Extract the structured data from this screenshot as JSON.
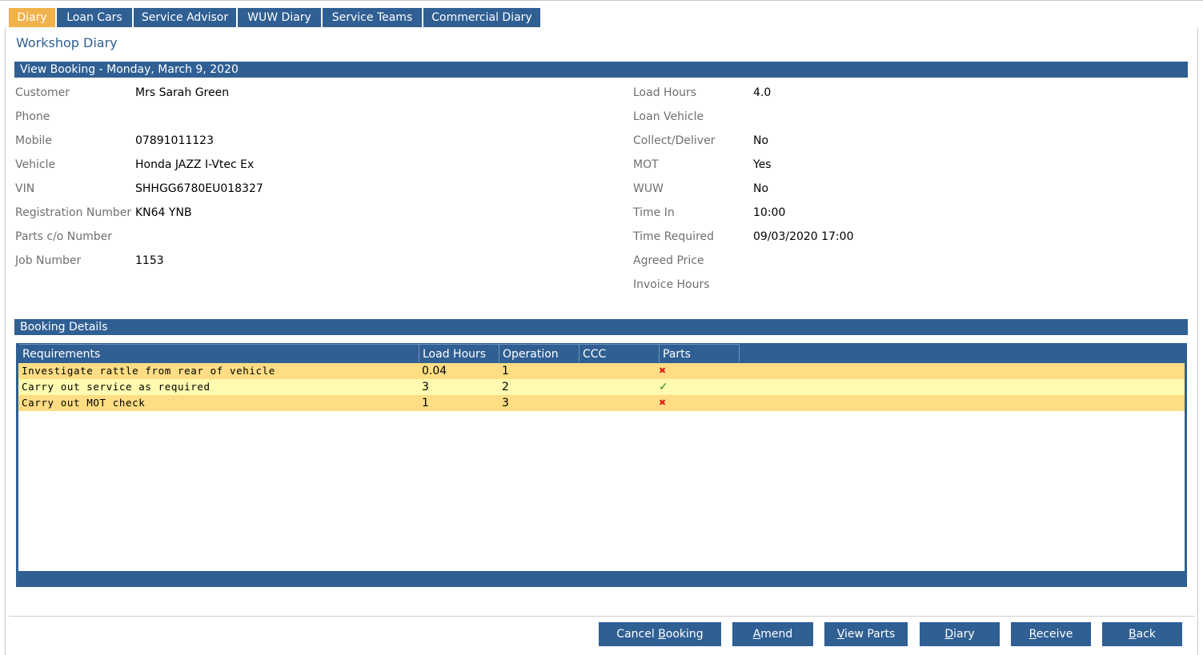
{
  "tabs": [
    {
      "label": "Diary",
      "active": true
    },
    {
      "label": "Loan Cars",
      "active": false
    },
    {
      "label": "Service Advisor",
      "active": false
    },
    {
      "label": "WUW Diary",
      "active": false
    },
    {
      "label": "Service Teams",
      "active": false
    },
    {
      "label": "Commercial Diary",
      "active": false
    }
  ],
  "page_title": "Workshop Diary",
  "booking_header": "View Booking - Monday, March 9, 2020",
  "left_fields": [
    {
      "label": "Customer",
      "value": "Mrs Sarah Green"
    },
    {
      "label": "Phone",
      "value": ""
    },
    {
      "label": "Mobile",
      "value": "07891011123"
    },
    {
      "label": "Vehicle",
      "value": "Honda JAZZ I-Vtec Ex"
    },
    {
      "label": "VIN",
      "value": "SHHGG6780EU018327"
    },
    {
      "label": "Registration Number",
      "value": "KN64 YNB"
    },
    {
      "label": "Parts c/o Number",
      "value": ""
    },
    {
      "label": "Job Number",
      "value": "1153"
    }
  ],
  "right_fields": [
    {
      "label": "Load Hours",
      "value": "4.0"
    },
    {
      "label": "Loan Vehicle",
      "value": ""
    },
    {
      "label": "Collect/Deliver",
      "value": "No"
    },
    {
      "label": "MOT",
      "value": "Yes"
    },
    {
      "label": "WUW",
      "value": "No"
    },
    {
      "label": "Time In",
      "value": "10:00"
    },
    {
      "label": "Time Required",
      "value": "09/03/2020 17:00"
    },
    {
      "label": "Agreed Price",
      "value": ""
    },
    {
      "label": "Invoice Hours",
      "value": ""
    }
  ],
  "details_header": "Booking Details",
  "grid": {
    "columns": [
      "Requirements",
      "Load Hours",
      "Operation",
      "CCC",
      "Parts"
    ],
    "rows": [
      {
        "requirement": "Investigate rattle from rear of vehicle",
        "load_hours": "0.04",
        "operation": "1",
        "ccc": "",
        "parts": "cross"
      },
      {
        "requirement": "Carry out service as required",
        "load_hours": "3",
        "operation": "2",
        "ccc": "",
        "parts": "tick"
      },
      {
        "requirement": "Carry out MOT check",
        "load_hours": "1",
        "operation": "3",
        "ccc": "",
        "parts": "cross"
      }
    ],
    "icons": {
      "cross": "✖",
      "tick": "✓"
    }
  },
  "buttons": {
    "cancel_booking": {
      "pre": "Cancel ",
      "ul": "B",
      "post": "ooking"
    },
    "amend": {
      "pre": "",
      "ul": "A",
      "post": "mend"
    },
    "view_parts": {
      "pre": "",
      "ul": "V",
      "post": "iew Parts"
    },
    "diary": {
      "pre": "",
      "ul": "D",
      "post": "iary"
    },
    "receive": {
      "pre": "",
      "ul": "R",
      "post": "eceive"
    },
    "back": {
      "pre": "",
      "ul": "B",
      "post": "ack"
    }
  },
  "colors": {
    "accent": "#2f5f93",
    "active_tab": "#f0b24a",
    "row_odd": "#fedd84",
    "row_even": "#fefaaf"
  }
}
